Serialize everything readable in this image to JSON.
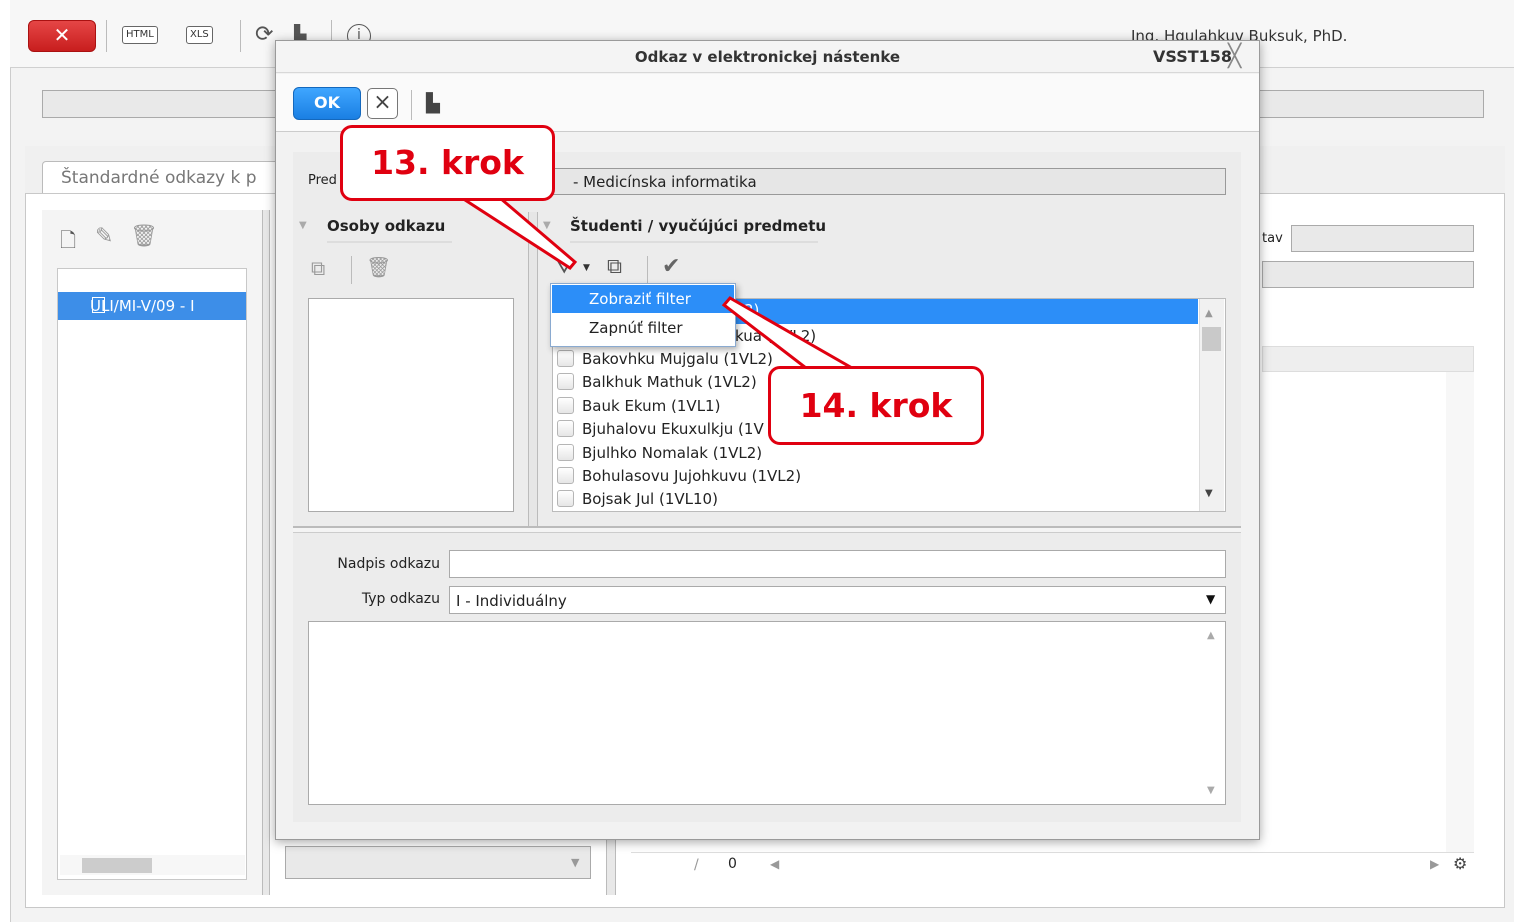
{
  "app": {
    "toolbar": {
      "close_label": "✕",
      "html_label": "HTML",
      "xls_label": "XLS",
      "info_label": "i"
    },
    "user_name": "Ing. Hqulahkuv Buksuk, PhD.",
    "tab_label": "Štandardné odkazy k p",
    "tree_item_label": "ULI/MI-V/09 - I",
    "right_field_label": "tav",
    "pager_sep": "/",
    "pager_value": "0"
  },
  "dialog": {
    "title": "Odkaz v elektronickej nástenke",
    "code": "VSST158",
    "ok_label": "OK",
    "predmet_label": "Pred",
    "predmet_value": "- Medicínska informatika",
    "osoby_header": "Osoby odkazu",
    "studenti_header": "Študenti / vyučújúci predmetu",
    "list_items": [
      {
        "label": "2)",
        "selected": true
      },
      {
        "label": "kua       (1VL2)",
        "selected": false
      },
      {
        "label": "Bakovhku Mujgalu (1VL2)",
        "selected": false
      },
      {
        "label": "Balkhuk Mathuk (1VL2)",
        "selected": false
      },
      {
        "label": "Bauk Ekum (1VL1)",
        "selected": false
      },
      {
        "label": "Bjuhalovu Ekuxulkju (1V",
        "selected": false
      },
      {
        "label": "Bjulhko Nomalak (1VL2)",
        "selected": false
      },
      {
        "label": "Bohulasovu Jujohkuvu (1VL2)",
        "selected": false
      },
      {
        "label": "Bojsak Jul (1VL10)",
        "selected": false
      }
    ],
    "nadpis_label": "Nadpis odkazu",
    "nadpis_value": "",
    "typ_label": "Typ odkazu",
    "typ_value": "I - Individuálny"
  },
  "filter_menu": {
    "items": [
      "Zobraziť filter",
      "Zapnúť filter"
    ],
    "selected_index": 0
  },
  "callouts": {
    "step13": "13. krok",
    "step14": "14. krok"
  },
  "colors": {
    "accent_blue": "#2c8ef8",
    "callout_red": "#e00010",
    "close_red": "#d62a2a"
  }
}
